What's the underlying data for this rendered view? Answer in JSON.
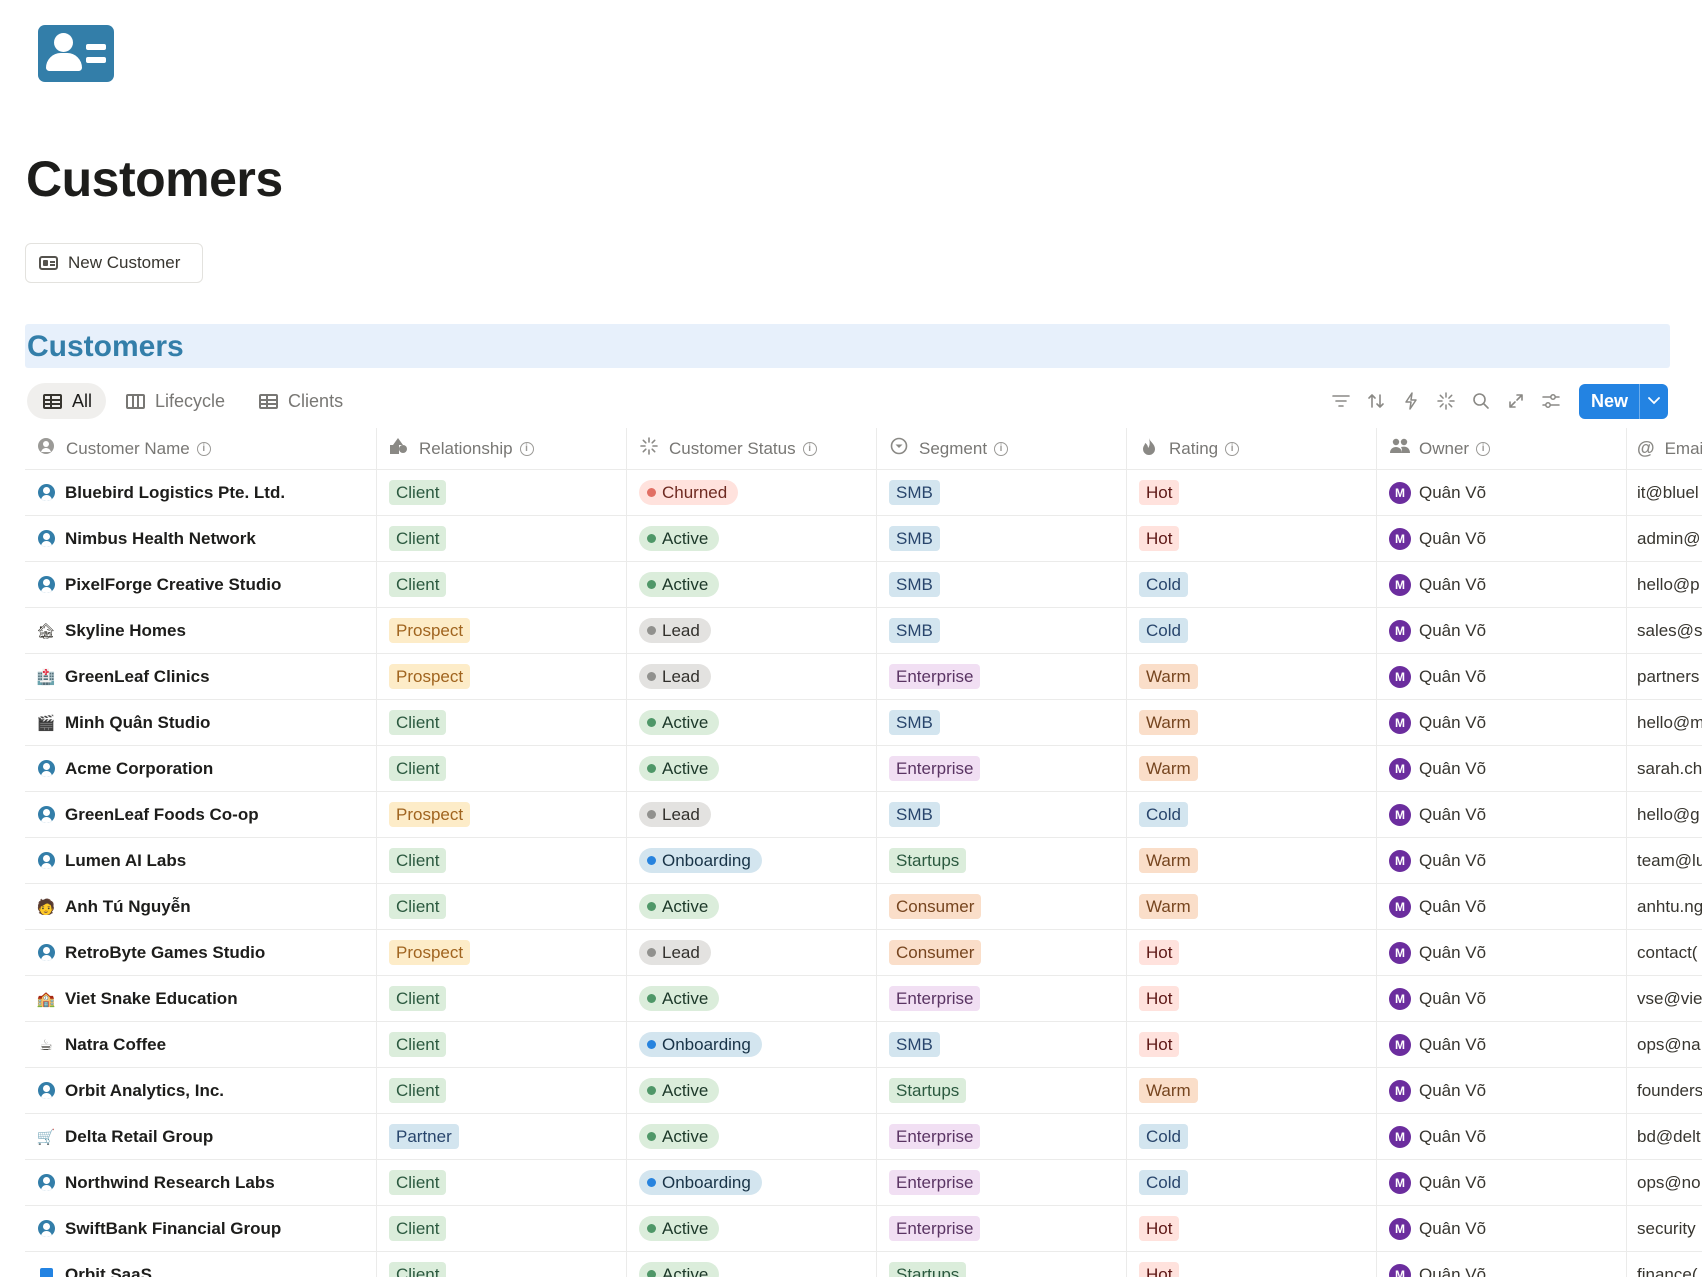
{
  "page": {
    "icon": "contact-card-icon",
    "title": "Customers",
    "new_button_label": "New Customer"
  },
  "database": {
    "title": "Customers",
    "views": [
      {
        "label": "All",
        "icon": "table-icon",
        "active": true
      },
      {
        "label": "Lifecycle",
        "icon": "board-icon",
        "active": false
      },
      {
        "label": "Clients",
        "icon": "table-icon",
        "active": false
      }
    ],
    "toolbar": {
      "icons": [
        "filter-icon",
        "sort-icon",
        "automation-icon",
        "ai-icon",
        "search-icon",
        "expand-icon",
        "settings-icon"
      ],
      "new_label": "New"
    }
  },
  "columns": [
    {
      "label": "Customer Name",
      "icon": "person-circle-icon"
    },
    {
      "label": "Relationship",
      "icon": "shapes-icon"
    },
    {
      "label": "Customer Status",
      "icon": "status-icon"
    },
    {
      "label": "Segment",
      "icon": "select-icon"
    },
    {
      "label": "Rating",
      "icon": "flame-icon"
    },
    {
      "label": "Owner",
      "icon": "people-icon"
    },
    {
      "label": "Emai",
      "icon": "at-icon"
    }
  ],
  "colors": {
    "Client": {
      "bg": "#dbeddb",
      "fg": "#2b593f"
    },
    "Prospect": {
      "bg": "#fdecc8",
      "fg": "#a0641f"
    },
    "Partner": {
      "bg": "#d3e5ef",
      "fg": "#28456c"
    },
    "Churned": {
      "bg": "#ffe2dd",
      "fg": "#6e2a21",
      "dot": "#e16f64"
    },
    "Active": {
      "bg": "#dbeddb",
      "fg": "#1c3829",
      "dot": "#4f9768"
    },
    "Lead": {
      "bg": "#e3e2e0",
      "fg": "#32302c",
      "dot": "#91918e"
    },
    "Onboarding": {
      "bg": "#d3e5ef",
      "fg": "#183347",
      "dot": "#2783de"
    },
    "SMB": {
      "bg": "#d3e5ef",
      "fg": "#28456c"
    },
    "Enterprise": {
      "bg": "#f1dff3",
      "fg": "#5a3463"
    },
    "Startups": {
      "bg": "#dbeddb",
      "fg": "#2b593f"
    },
    "Consumer": {
      "bg": "#fadec9",
      "fg": "#76451f"
    },
    "Hot": {
      "bg": "#ffe2dd",
      "fg": "#5d1715"
    },
    "Cold": {
      "bg": "#d3e5ef",
      "fg": "#28456c"
    },
    "Warm": {
      "bg": "#fadec9",
      "fg": "#76451f"
    }
  },
  "rows": [
    {
      "name": "Bluebird Logistics Pte. Ltd.",
      "icon": "person-icon",
      "relationship": "Client",
      "status": "Churned",
      "segment": "SMB",
      "rating": "Hot",
      "owner": "Quân Võ",
      "owner_initial": "M",
      "email": "it@bluel"
    },
    {
      "name": "Nimbus Health Network",
      "icon": "person-icon",
      "relationship": "Client",
      "status": "Active",
      "segment": "SMB",
      "rating": "Hot",
      "owner": "Quân Võ",
      "owner_initial": "M",
      "email": "admin@"
    },
    {
      "name": "PixelForge Creative Studio",
      "icon": "person-icon",
      "relationship": "Client",
      "status": "Active",
      "segment": "SMB",
      "rating": "Cold",
      "owner": "Quân Võ",
      "owner_initial": "M",
      "email": "hello@p"
    },
    {
      "name": "Skyline Homes",
      "icon": "house-icon",
      "relationship": "Prospect",
      "status": "Lead",
      "segment": "SMB",
      "rating": "Cold",
      "owner": "Quân Võ",
      "owner_initial": "M",
      "email": "sales@sl"
    },
    {
      "name": "GreenLeaf Clinics",
      "icon": "hospital-icon",
      "relationship": "Prospect",
      "status": "Lead",
      "segment": "Enterprise",
      "rating": "Warm",
      "owner": "Quân Võ",
      "owner_initial": "M",
      "email": "partners"
    },
    {
      "name": "Minh Quân Studio",
      "icon": "clapperboard-icon",
      "relationship": "Client",
      "status": "Active",
      "segment": "SMB",
      "rating": "Warm",
      "owner": "Quân Võ",
      "owner_initial": "M",
      "email": "hello@m"
    },
    {
      "name": "Acme Corporation",
      "icon": "person-icon",
      "relationship": "Client",
      "status": "Active",
      "segment": "Enterprise",
      "rating": "Warm",
      "owner": "Quân Võ",
      "owner_initial": "M",
      "email": "sarah.ch"
    },
    {
      "name": "GreenLeaf Foods Co-op",
      "icon": "person-icon",
      "relationship": "Prospect",
      "status": "Lead",
      "segment": "SMB",
      "rating": "Cold",
      "owner": "Quân Võ",
      "owner_initial": "M",
      "email": "hello@g"
    },
    {
      "name": "Lumen AI Labs",
      "icon": "person-icon",
      "relationship": "Client",
      "status": "Onboarding",
      "segment": "Startups",
      "rating": "Warm",
      "owner": "Quân Võ",
      "owner_initial": "M",
      "email": "team@lu"
    },
    {
      "name": "Anh Tú Nguyễn",
      "icon": "person-emoji-icon",
      "relationship": "Client",
      "status": "Active",
      "segment": "Consumer",
      "rating": "Warm",
      "owner": "Quân Võ",
      "owner_initial": "M",
      "email": "anhtu.ng"
    },
    {
      "name": "RetroByte Games Studio",
      "icon": "person-icon",
      "relationship": "Prospect",
      "status": "Lead",
      "segment": "Consumer",
      "rating": "Hot",
      "owner": "Quân Võ",
      "owner_initial": "M",
      "email": "contact("
    },
    {
      "name": "Viet Snake Education",
      "icon": "school-icon",
      "relationship": "Client",
      "status": "Active",
      "segment": "Enterprise",
      "rating": "Hot",
      "owner": "Quân Võ",
      "owner_initial": "M",
      "email": "vse@vie"
    },
    {
      "name": "Natra Coffee",
      "icon": "coffee-icon",
      "relationship": "Client",
      "status": "Onboarding",
      "segment": "SMB",
      "rating": "Hot",
      "owner": "Quân Võ",
      "owner_initial": "M",
      "email": "ops@na"
    },
    {
      "name": "Orbit Analytics, Inc.",
      "icon": "person-icon",
      "relationship": "Client",
      "status": "Active",
      "segment": "Startups",
      "rating": "Warm",
      "owner": "Quân Võ",
      "owner_initial": "M",
      "email": "founders"
    },
    {
      "name": "Delta Retail Group",
      "icon": "cart-icon",
      "relationship": "Partner",
      "status": "Active",
      "segment": "Enterprise",
      "rating": "Cold",
      "owner": "Quân Võ",
      "owner_initial": "M",
      "email": "bd@delt"
    },
    {
      "name": "Northwind Research Labs",
      "icon": "person-icon",
      "relationship": "Client",
      "status": "Onboarding",
      "segment": "Enterprise",
      "rating": "Cold",
      "owner": "Quân Võ",
      "owner_initial": "M",
      "email": "ops@no"
    },
    {
      "name": "SwiftBank Financial Group",
      "icon": "person-icon",
      "relationship": "Client",
      "status": "Active",
      "segment": "Enterprise",
      "rating": "Hot",
      "owner": "Quân Võ",
      "owner_initial": "M",
      "email": "security"
    },
    {
      "name": "Orbit SaaS",
      "icon": "square-icon",
      "relationship": "Client",
      "status": "Active",
      "segment": "Startups",
      "rating": "Hot",
      "owner": "Quân Võ",
      "owner_initial": "M",
      "email": "finance("
    }
  ]
}
